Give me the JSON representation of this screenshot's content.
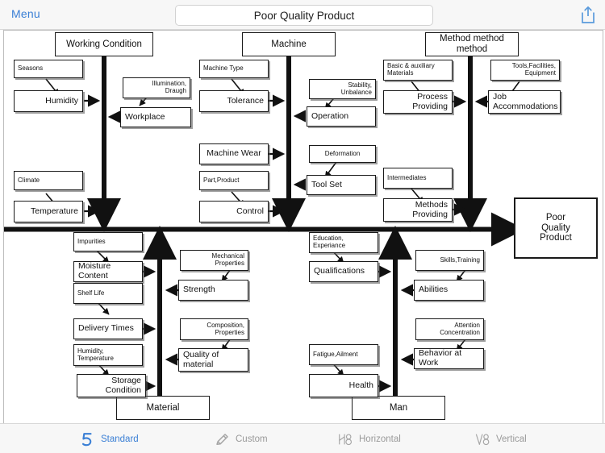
{
  "topbar": {
    "menu_label": "Menu",
    "title_value": "Poor Quality Product",
    "title_placeholder": "Title",
    "share_icon": "share-icon",
    "accent_color": "#3a7fd5"
  },
  "diagram": {
    "type": "fishbone-ishikawa",
    "head": {
      "label": "Poor\nQuality\nProduct"
    },
    "categories": [
      {
        "name": "working-condition",
        "header": "Working Condition",
        "causes": [
          {
            "label": "Seasons"
          },
          {
            "label": "Humidity"
          },
          {
            "label": "Illumination,\nDraugh"
          },
          {
            "label": "Workplace"
          },
          {
            "label": "Climate"
          },
          {
            "label": "Temperature"
          }
        ]
      },
      {
        "name": "machine",
        "header": "Machine",
        "causes": [
          {
            "label": "Machine Type"
          },
          {
            "label": "Tolerance"
          },
          {
            "label": "Stability,\nUnbalance"
          },
          {
            "label": "Operation"
          },
          {
            "label": "Machine Wear"
          },
          {
            "label": "Deformation"
          },
          {
            "label": "Tool Set"
          },
          {
            "label": "Part,Product"
          },
          {
            "label": "Control"
          }
        ]
      },
      {
        "name": "method",
        "header": "Method method\nmethod",
        "causes": [
          {
            "label": "Basic & auxiliary\nMaterials"
          },
          {
            "label": "Process\nProviding"
          },
          {
            "label": "Tools,Facilities,\nEquipment"
          },
          {
            "label": "Job\nAccommodations"
          },
          {
            "label": "Intermediates"
          },
          {
            "label": "Methods\nProviding"
          }
        ]
      },
      {
        "name": "material",
        "header": "Material",
        "causes": [
          {
            "label": "Impurities"
          },
          {
            "label": "Moisture Content"
          },
          {
            "label": "Mechanical\nProperties"
          },
          {
            "label": "Strength"
          },
          {
            "label": "Shelf Life"
          },
          {
            "label": "Delivery Times"
          },
          {
            "label": "Composition,\nProperties"
          },
          {
            "label": "Quality of\nmaterial"
          },
          {
            "label": "Humidity,\nTemperature"
          },
          {
            "label": "Storage\nCondition"
          }
        ]
      },
      {
        "name": "man",
        "header": "Man",
        "causes": [
          {
            "label": "Education,\nExperiance"
          },
          {
            "label": "Qualifications"
          },
          {
            "label": "Skills,Training"
          },
          {
            "label": "Abilities"
          },
          {
            "label": "Attention\nConcentration"
          },
          {
            "label": "Behavior at Work"
          },
          {
            "label": "Fatigue,Ailment"
          },
          {
            "label": "Health"
          }
        ]
      }
    ]
  },
  "tabbar": {
    "tabs": [
      {
        "label": "Standard",
        "icon": "numeral-five-icon",
        "active": true
      },
      {
        "label": "Custom",
        "icon": "pencil-icon",
        "active": false
      },
      {
        "label": "Horizontal",
        "icon": "h8-icon",
        "active": false
      },
      {
        "label": "Vertical",
        "icon": "v8-icon",
        "active": false
      }
    ]
  }
}
